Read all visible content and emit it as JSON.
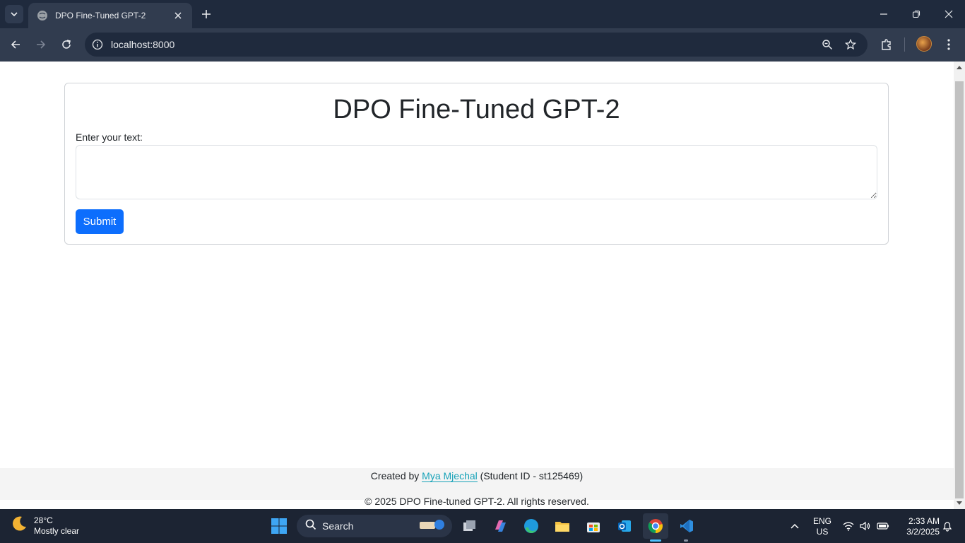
{
  "browser": {
    "tab_title": "DPO Fine-Tuned GPT-2",
    "url": "localhost:8000"
  },
  "page": {
    "heading": "DPO Fine-Tuned GPT-2",
    "input_label": "Enter your text:",
    "input_value": "",
    "submit_label": "Submit",
    "footer": {
      "created_by_prefix": "Created by",
      "author_name": "Mya Mjechal",
      "student_id_text": "(Student ID - st125469)",
      "copyright": "© 2025 DPO Fine-tuned GPT-2. All rights reserved."
    }
  },
  "taskbar": {
    "weather_temp": "28°C",
    "weather_desc": "Mostly clear",
    "search_label": "Search",
    "language_top": "ENG",
    "language_bottom": "US",
    "time": "2:33 AM",
    "date": "3/2/2025"
  },
  "colors": {
    "primary_button": "#0d6efd",
    "link": "#17a2b8",
    "chrome_dark": "#1f2a3d"
  },
  "icons": [
    "tab-search-icon",
    "globe-icon",
    "close-icon",
    "plus-icon",
    "minimize-icon",
    "restore-icon",
    "window-close-icon",
    "back-icon",
    "forward-icon",
    "reload-icon",
    "info-icon",
    "zoom-icon",
    "star-icon",
    "extensions-icon",
    "menu-icon",
    "weather-moon-icon",
    "windows-start-icon",
    "search-icon"
  ]
}
